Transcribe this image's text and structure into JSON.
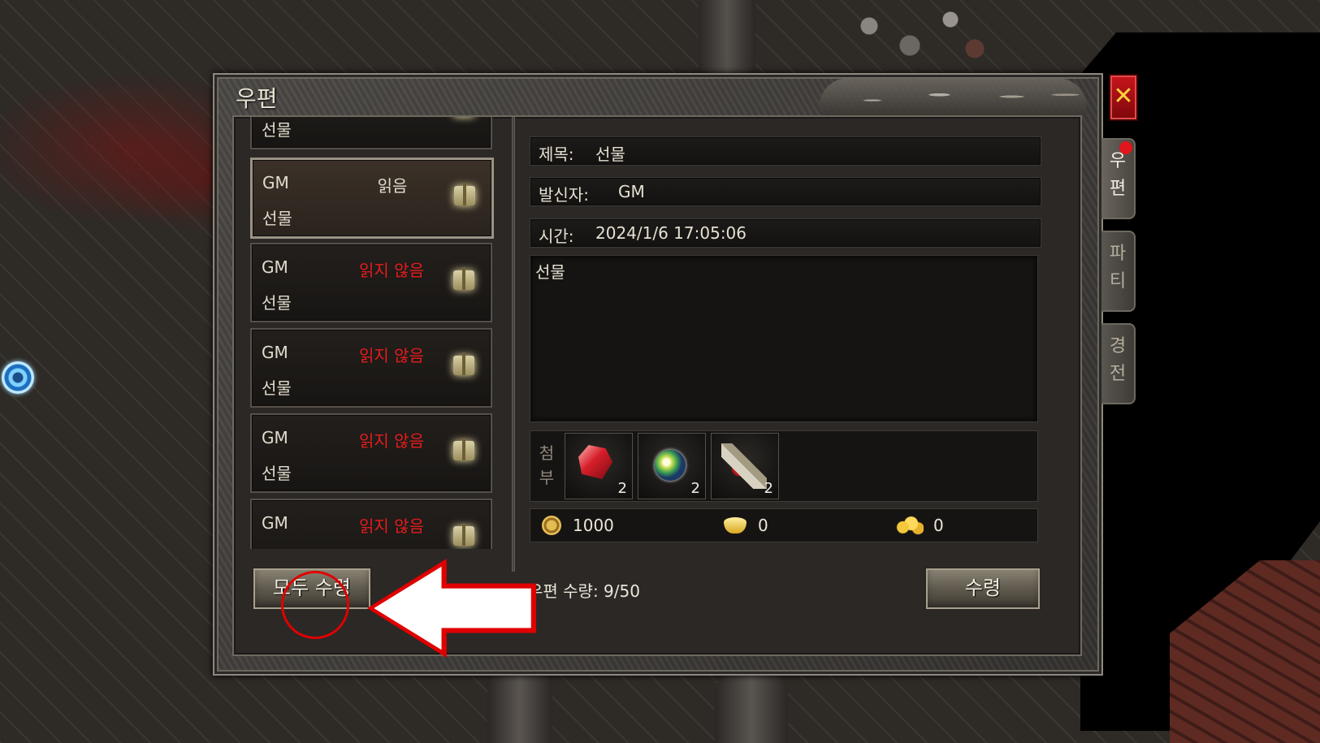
{
  "window": {
    "title": "우편",
    "close_glyph": "✕"
  },
  "side_tabs": [
    {
      "label": "우\n편",
      "active": true,
      "badge": true
    },
    {
      "label": "파\n티",
      "active": false,
      "badge": false
    },
    {
      "label": "경\n전",
      "active": false,
      "badge": false
    }
  ],
  "mail_list": [
    {
      "sender": "",
      "status": "",
      "status_type": "read",
      "subject": "선물",
      "selected": false,
      "partial": "top"
    },
    {
      "sender": "GM",
      "status": "읽음",
      "status_type": "read",
      "subject": "선물",
      "selected": true
    },
    {
      "sender": "GM",
      "status": "읽지 않음",
      "status_type": "unread",
      "subject": "선물",
      "selected": false
    },
    {
      "sender": "GM",
      "status": "읽지 않음",
      "status_type": "unread",
      "subject": "선물",
      "selected": false
    },
    {
      "sender": "GM",
      "status": "읽지 않음",
      "status_type": "unread",
      "subject": "선물",
      "selected": false
    },
    {
      "sender": "GM",
      "status": "읽지 않음",
      "status_type": "unread",
      "subject": "",
      "selected": false,
      "partial": "bottom"
    }
  ],
  "detail": {
    "subject_label": "제목:",
    "subject_value": "선물",
    "sender_label": "발신자:",
    "sender_value": "GM",
    "time_label": "시간:",
    "time_value": "2024/1/6 17:05:06",
    "body": "선물",
    "attach_label": "첨\n부",
    "attachments": [
      {
        "icon": "red-crystal-icon",
        "count": "2"
      },
      {
        "icon": "green-orb-icon",
        "count": "2"
      },
      {
        "icon": "scroll-icon",
        "count": "2"
      }
    ],
    "currency": {
      "gold_coin": "1000",
      "gold_ingot": "0",
      "gold_nugget": "0"
    }
  },
  "footer": {
    "claim_all_label": "모두 수령",
    "mail_count_label": "우편 수량: 9/50",
    "claim_label": "수령"
  },
  "colors": {
    "unread": "#e41c1c",
    "read": "#e2dccd",
    "annotation": "#e00000"
  }
}
